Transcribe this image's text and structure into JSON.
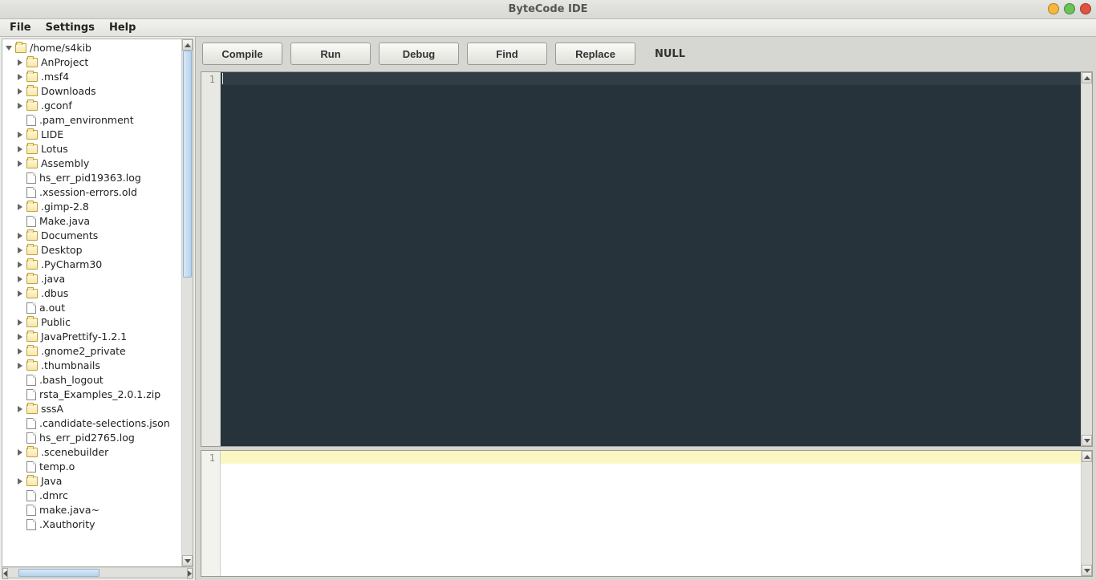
{
  "window": {
    "title": "ByteCode IDE"
  },
  "menu": {
    "file": "File",
    "settings": "Settings",
    "help": "Help"
  },
  "toolbar": {
    "compile": "Compile",
    "run": "Run",
    "debug": "Debug",
    "find": "Find",
    "replace": "Replace",
    "status": "NULL"
  },
  "editor": {
    "top_line_number": "1",
    "bottom_line_number": "1"
  },
  "tree": {
    "root_label": "/home/s4kib",
    "items": [
      {
        "type": "folder",
        "expandable": true,
        "label": "AnProject"
      },
      {
        "type": "folder",
        "expandable": true,
        "label": ".msf4"
      },
      {
        "type": "folder",
        "expandable": true,
        "label": "Downloads"
      },
      {
        "type": "folder",
        "expandable": true,
        "label": ".gconf"
      },
      {
        "type": "file",
        "expandable": false,
        "label": ".pam_environment"
      },
      {
        "type": "folder",
        "expandable": true,
        "label": "LIDE"
      },
      {
        "type": "folder",
        "expandable": true,
        "label": "Lotus"
      },
      {
        "type": "folder",
        "expandable": true,
        "label": "Assembly"
      },
      {
        "type": "file",
        "expandable": false,
        "label": "hs_err_pid19363.log"
      },
      {
        "type": "file",
        "expandable": false,
        "label": ".xsession-errors.old"
      },
      {
        "type": "folder",
        "expandable": true,
        "label": ".gimp-2.8"
      },
      {
        "type": "file",
        "expandable": false,
        "label": "Make.java"
      },
      {
        "type": "folder",
        "expandable": true,
        "label": "Documents"
      },
      {
        "type": "folder",
        "expandable": true,
        "label": "Desktop"
      },
      {
        "type": "folder",
        "expandable": true,
        "label": ".PyCharm30"
      },
      {
        "type": "folder",
        "expandable": true,
        "label": ".java"
      },
      {
        "type": "folder",
        "expandable": true,
        "label": ".dbus"
      },
      {
        "type": "file",
        "expandable": false,
        "label": "a.out"
      },
      {
        "type": "folder",
        "expandable": true,
        "label": "Public"
      },
      {
        "type": "folder",
        "expandable": true,
        "label": "JavaPrettify-1.2.1"
      },
      {
        "type": "folder",
        "expandable": true,
        "label": ".gnome2_private"
      },
      {
        "type": "folder",
        "expandable": true,
        "label": ".thumbnails"
      },
      {
        "type": "file",
        "expandable": false,
        "label": ".bash_logout"
      },
      {
        "type": "file",
        "expandable": false,
        "label": "rsta_Examples_2.0.1.zip"
      },
      {
        "type": "folder",
        "expandable": true,
        "label": "sssA"
      },
      {
        "type": "file",
        "expandable": false,
        "label": ".candidate-selections.json"
      },
      {
        "type": "file",
        "expandable": false,
        "label": "hs_err_pid2765.log"
      },
      {
        "type": "folder",
        "expandable": true,
        "label": ".scenebuilder"
      },
      {
        "type": "file",
        "expandable": false,
        "label": "temp.o"
      },
      {
        "type": "folder",
        "expandable": true,
        "label": "Java"
      },
      {
        "type": "file",
        "expandable": false,
        "label": ".dmrc"
      },
      {
        "type": "file",
        "expandable": false,
        "label": "make.java~"
      },
      {
        "type": "file",
        "expandable": false,
        "label": ".Xauthority"
      }
    ]
  }
}
